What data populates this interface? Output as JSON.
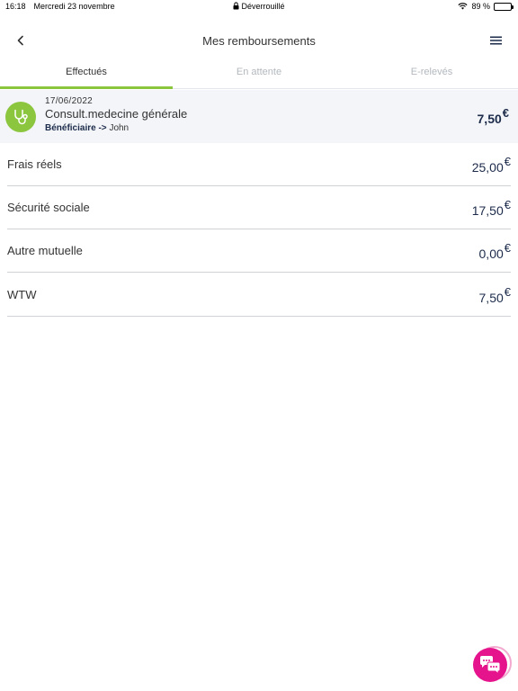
{
  "status_bar": {
    "time": "16:18",
    "date": "Mercredi 23 novembre",
    "lock_text": "Déverrouillé",
    "battery": "89 %",
    "battery_level": 0.89
  },
  "header": {
    "title": "Mes remboursements",
    "back_icon": "chevron-left-icon",
    "menu_icon": "hamburger-menu-icon"
  },
  "tabs": [
    {
      "label": "Effectués",
      "active": true
    },
    {
      "label": "En attente",
      "active": false
    },
    {
      "label": "E-relevés",
      "active": false
    }
  ],
  "claim": {
    "icon": "stethoscope-icon",
    "date": "17/06/2022",
    "label": "Consult.medecine générale",
    "beneficiary_label": "Bénéficiaire ->",
    "beneficiary_name": "John",
    "amount": "7,50",
    "currency": "€"
  },
  "details": [
    {
      "label": "Frais réels",
      "amount": "25,00",
      "currency": "€"
    },
    {
      "label": "Sécurité sociale",
      "amount": "17,50",
      "currency": "€"
    },
    {
      "label": "Autre mutuelle",
      "amount": "0,00",
      "currency": "€"
    },
    {
      "label": "WTW",
      "amount": "7,50",
      "currency": "€"
    }
  ],
  "colors": {
    "accent_green": "#8cc63f",
    "navy": "#1c2b4a",
    "chat_pink": "#e6148c"
  },
  "chat_icon": "chat-bubbles-icon"
}
